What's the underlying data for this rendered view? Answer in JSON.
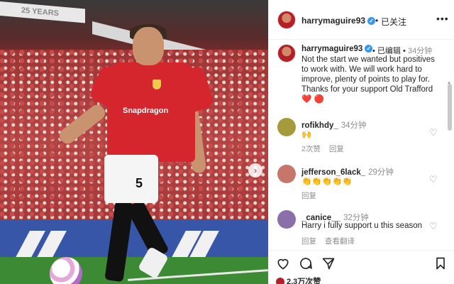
{
  "photo": {
    "banner_text": "25 YEARS",
    "sponsor": "Snapdragon",
    "shorts_number": "5",
    "next_icon": "chevron-right-icon"
  },
  "header": {
    "username": "harrymaguire93",
    "verified_icon": "verified-badge-icon",
    "separator": "•",
    "follow_status": "已关注",
    "more_icon": "more-horizontal-icon"
  },
  "caption": {
    "username": "harrymaguire93",
    "edited": "• 已编辑 •",
    "time": "34分钟",
    "text": "Not the start we wanted but positives to work with. We will work hard to improve, plenty of points to play for. Thanks for your support Old Trafford",
    "emojis": "❤️ 🔴"
  },
  "comments": [
    {
      "username": "rofikhdy_",
      "time": "34分钟",
      "text": "🙌",
      "likes": "2次赞",
      "reply": "回复"
    },
    {
      "username": "jefferson_6lack_",
      "time": "29分钟",
      "text": "👏👏👏👏👏",
      "likes": "",
      "reply": "回复"
    },
    {
      "username": "_canice__",
      "time": "32分钟",
      "text": "Harry i fully support u this season",
      "likes": "回复",
      "reply": "查看翻译"
    }
  ],
  "actions": {
    "like_icon": "heart-icon",
    "comment_icon": "comment-icon",
    "share_icon": "send-icon",
    "save_icon": "bookmark-icon",
    "likes_count": "2.3万次赞"
  },
  "colors": {
    "verified": "#3897f0",
    "jersey": "#d4262c",
    "muted": "#8e8e8e"
  }
}
